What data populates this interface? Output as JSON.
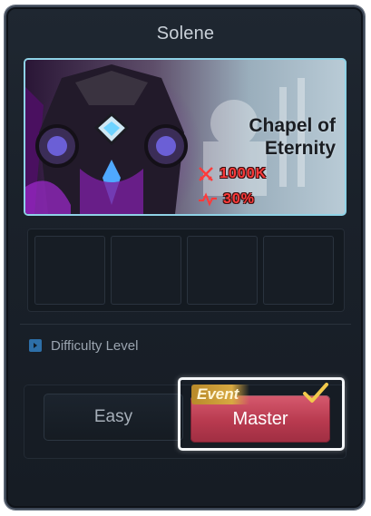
{
  "window": {
    "title": "Solene"
  },
  "stage": {
    "name": "Chapel of Eternity",
    "power_requirement": "1000K",
    "stat_percent": "30%"
  },
  "slots": {
    "count": 4
  },
  "difficulty": {
    "section_label": "Difficulty Level",
    "options": [
      {
        "label": "Easy",
        "selected": false
      },
      {
        "label": "Master",
        "selected": true,
        "badge": "Event"
      }
    ]
  },
  "colors": {
    "accent_red": "#ff3b3b",
    "selected_button": "#c0465a",
    "frame_highlight": "#8fd2e6",
    "check_gold": "#f2c94c"
  }
}
